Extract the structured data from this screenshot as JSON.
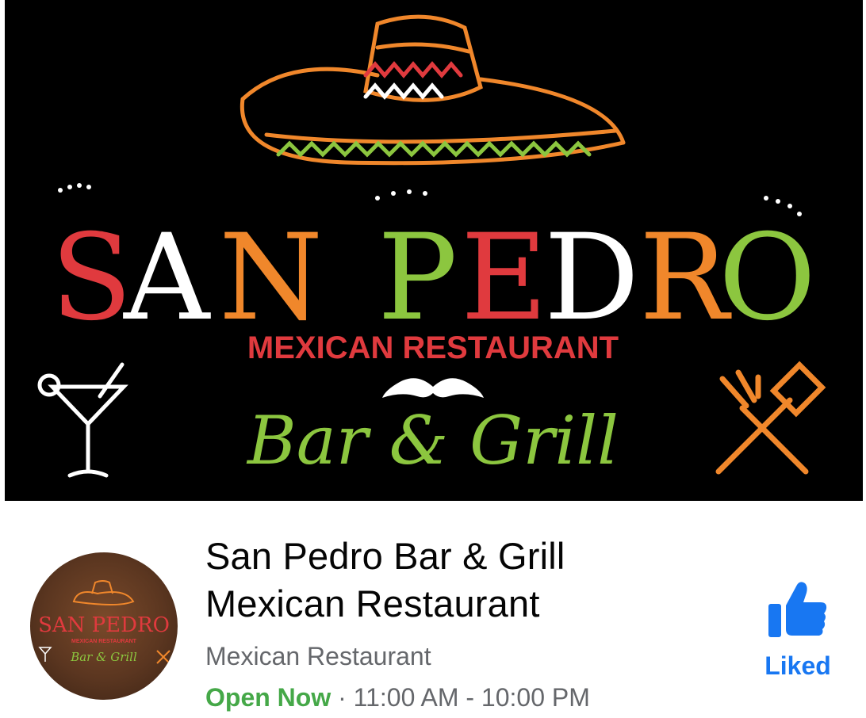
{
  "cover": {
    "brand_main": "SAN PEDRO",
    "brand_subtitle": "MEXICAN RESTAURANT",
    "brand_tagline": "Bar & Grill",
    "icons": [
      "sombrero-icon",
      "mustache-icon",
      "martini-glass-icon",
      "grill-tools-icon"
    ],
    "colors": {
      "red": "#e03a3e",
      "green": "#8cc63f",
      "orange": "#f0872b",
      "white": "#ffffff",
      "background": "#000000"
    }
  },
  "profile": {
    "avatar_brand": "SAN PEDRO",
    "avatar_subtitle": "MEXICAN RESTAURANT",
    "avatar_tagline": "Bar & Grill"
  },
  "page": {
    "name_line1": "San Pedro Bar & Grill",
    "name_line2": "Mexican Restaurant",
    "category": "Mexican Restaurant",
    "status": "Open Now",
    "separator": " · ",
    "hours": "11:00 AM - 10:00 PM"
  },
  "like": {
    "label": "Liked",
    "icon": "thumbs-up-icon",
    "color": "#1877f2"
  }
}
